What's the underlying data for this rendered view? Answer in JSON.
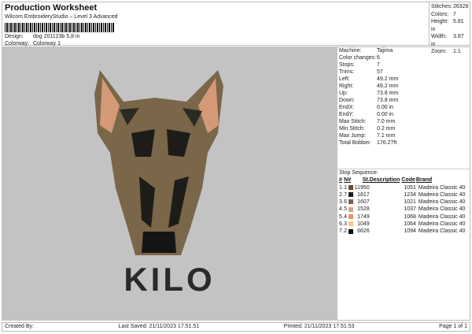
{
  "header": {
    "title": "Production Worksheet",
    "subtitle": "Wilcom EmbroideryStudio – Level 3 Advanced",
    "design_label": "Design:",
    "design_value": "dog 201123b 5,8 in",
    "colorway_label": "Colorway:",
    "colorway_value": "Colorway 1"
  },
  "stats": [
    {
      "label": "Stitches:",
      "value": "26328"
    },
    {
      "label": "Colors:",
      "value": "7"
    },
    {
      "label": "Height:",
      "value": "5.81 in"
    },
    {
      "label": "Width:",
      "value": "3.87 in"
    },
    {
      "label": "Zoom:",
      "value": "1:1"
    }
  ],
  "design_text": "KILO",
  "properties": [
    {
      "label": "Machine:",
      "value": "Tajima"
    },
    {
      "label": "Color changes:",
      "value": "6"
    },
    {
      "label": "Stops:",
      "value": "7"
    },
    {
      "label": "Trims:",
      "value": "57"
    },
    {
      "label": "Left:",
      "value": "49.2 mm"
    },
    {
      "label": "Right:",
      "value": "49.2 mm"
    },
    {
      "label": "Up:",
      "value": "73.8 mm"
    },
    {
      "label": "Down:",
      "value": "73.8 mm"
    },
    {
      "label": "EndX:",
      "value": "0.00 in"
    },
    {
      "label": "EndY:",
      "value": "0.00 in"
    },
    {
      "label": "Max Stitch:",
      "value": "7.0 mm"
    },
    {
      "label": "Min Stitch:",
      "value": "0.2 mm"
    },
    {
      "label": "Max Jump:",
      "value": "7.1 mm"
    },
    {
      "label": "Total Bobbin:",
      "value": "176.27ft"
    }
  ],
  "sequence": {
    "title": "Stop Sequence:",
    "headers": [
      "#",
      "N#",
      "St.",
      "Description",
      "Code",
      "Brand"
    ],
    "rows": [
      {
        "n": "1.",
        "num": "1",
        "color": "#6b4e34",
        "st": "11950",
        "code": "1051",
        "brand": "Madeira Classic 40"
      },
      {
        "n": "2.",
        "num": "7",
        "color": "#1c1c1c",
        "st": "1817",
        "code": "1234",
        "brand": "Madeira Classic 40"
      },
      {
        "n": "3.",
        "num": "6",
        "color": "#7d5f52",
        "st": "1607",
        "code": "1021",
        "brand": "Madeira Classic 40"
      },
      {
        "n": "4.",
        "num": "5",
        "color": "#c8a88c",
        "st": "1528",
        "code": "1037",
        "brand": "Madeira Classic 40"
      },
      {
        "n": "5.",
        "num": "4",
        "color": "#e3946a",
        "st": "1749",
        "code": "1068",
        "brand": "Madeira Classic 40"
      },
      {
        "n": "6.",
        "num": "3",
        "color": "#f3c88a",
        "st": "1049",
        "code": "1064",
        "brand": "Madeira Classic 40"
      },
      {
        "n": "7.",
        "num": "2",
        "color": "#0c0c0c",
        "st": "6626",
        "code": "1094",
        "brand": "Madeira Classic 40"
      }
    ]
  },
  "footer": {
    "created": "Created By:",
    "saved": "Last Saved: 21/11/2023 17.51.51",
    "printed": "Printed: 21/11/2023 17.51.53",
    "page": "Page 1 of 1"
  }
}
